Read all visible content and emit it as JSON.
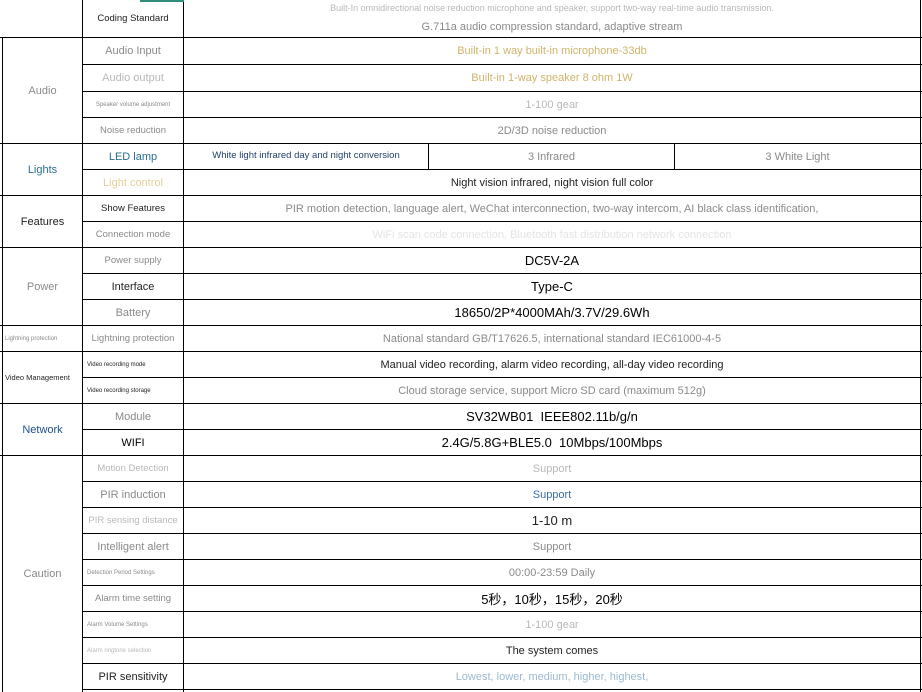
{
  "colors": {
    "lights": "#2a6f8f",
    "network": "#1f4f8a",
    "tan": "#d0b46a",
    "blue": "#3a6ea5"
  },
  "rows": {
    "coding": {
      "label": "Coding Standard",
      "v1": "Built-In omnidirectional noise reduction microphone and speaker, support two-way real-time audio transmission.",
      "v2": "G.711a audio compression standard, adaptive stream"
    },
    "audio_input": {
      "label": "Audio Input",
      "value": "Built-in 1 way built-in microphone-33db"
    },
    "audio_output": {
      "label": "Audio output",
      "value": "Built-in 1-way speaker 8 ohm 1W"
    },
    "speaker_volume": {
      "label": "Speaker volume adjustment",
      "value": "1-100 gear"
    },
    "noise_reduction": {
      "label": "Noise reduction",
      "value": "2D/3D noise reduction"
    },
    "led_lamp": {
      "label": "LED lamp",
      "a": "White light infrared day and night conversion",
      "b": "3 Infrared",
      "c": "3 White Light"
    },
    "light_control": {
      "label": "Light control",
      "value": "Night vision infrared, night vision full color"
    },
    "show_features": {
      "label": "Show Features",
      "value": "PIR motion detection, language alert, WeChat interconnection, two-way intercom, AI black class identification,"
    },
    "connection_mode": {
      "label": "Connection mode",
      "value": "WiFi scan code connection, Bluetooth fast distribution network connection"
    },
    "power_supply": {
      "label": "Power supply",
      "value": "DC5V-2A"
    },
    "interface": {
      "label": "Interface",
      "value": "Type-C"
    },
    "battery": {
      "label": "Battery",
      "value": "18650/2P*4000MAh/3.7V/29.6Wh"
    },
    "lightning": {
      "label": "Lightning protection",
      "value": "National standard GB/T17626.5, international standard IEC61000-4-5"
    },
    "video_mode": {
      "label": "Video recording mode",
      "value": "Manual video recording, alarm video recording, all-day video recording"
    },
    "video_storage": {
      "label": "Video recording storage",
      "value": "Cloud storage service, support Micro SD card (maximum 512g)"
    },
    "module": {
      "label": "Module",
      "value": "SV32WB01  IEEE802.11b/g/n"
    },
    "wifi": {
      "label": "WIFI",
      "value": "2.4G/5.8G+BLE5.0  10Mbps/100Mbps"
    },
    "motion_detection": {
      "label": "Motion Detection",
      "value": "Support"
    },
    "pir_induction": {
      "label": "PIR induction",
      "value": "Support"
    },
    "pir_distance": {
      "label": "PIR sensing distance",
      "value": "1-10 m"
    },
    "intelligent_alert": {
      "label": "Intelligent alert",
      "value": "Support"
    },
    "detection_period": {
      "label": "Detection Period Settings",
      "value": "00:00-23:59 Daily"
    },
    "alarm_time": {
      "label": "Alarm time setting",
      "value": "5秒，10秒，15秒，20秒"
    },
    "alarm_volume": {
      "label": "Alarm Volume Settings",
      "value": "1-100 gear"
    },
    "alarm_ringtone": {
      "label": "Alarm ringtone selection",
      "value": "The system comes"
    },
    "pir_sensitivity": {
      "label": "PIR sensitivity",
      "value": "Lowest, lower, medium, higher, highest,"
    }
  },
  "groups": {
    "audio": "Audio",
    "lights": "Lights",
    "features": "Features",
    "power": "Power",
    "lightning": "Lightning protection",
    "video": "Video Management",
    "network": "Network",
    "caution": "Caution"
  }
}
